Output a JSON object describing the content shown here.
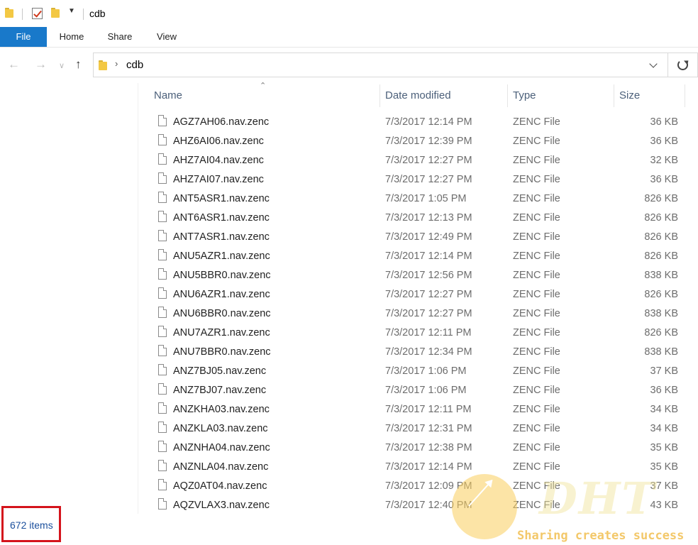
{
  "window": {
    "title": "cdb"
  },
  "ribbon": {
    "tabs": [
      "File",
      "Home",
      "Share",
      "View"
    ]
  },
  "address": {
    "path": "cdb"
  },
  "columns": {
    "name": "Name",
    "date": "Date modified",
    "type": "Type",
    "size": "Size"
  },
  "files": [
    {
      "name": "AGZ7AH06.nav.zenc",
      "date": "7/3/2017 12:14 PM",
      "type": "ZENC File",
      "size": "36 KB"
    },
    {
      "name": "AHZ6AI06.nav.zenc",
      "date": "7/3/2017 12:39 PM",
      "type": "ZENC File",
      "size": "36 KB"
    },
    {
      "name": "AHZ7AI04.nav.zenc",
      "date": "7/3/2017 12:27 PM",
      "type": "ZENC File",
      "size": "32 KB"
    },
    {
      "name": "AHZ7AI07.nav.zenc",
      "date": "7/3/2017 12:27 PM",
      "type": "ZENC File",
      "size": "36 KB"
    },
    {
      "name": "ANT5ASR1.nav.zenc",
      "date": "7/3/2017 1:05 PM",
      "type": "ZENC File",
      "size": "826 KB"
    },
    {
      "name": "ANT6ASR1.nav.zenc",
      "date": "7/3/2017 12:13 PM",
      "type": "ZENC File",
      "size": "826 KB"
    },
    {
      "name": "ANT7ASR1.nav.zenc",
      "date": "7/3/2017 12:49 PM",
      "type": "ZENC File",
      "size": "826 KB"
    },
    {
      "name": "ANU5AZR1.nav.zenc",
      "date": "7/3/2017 12:14 PM",
      "type": "ZENC File",
      "size": "826 KB"
    },
    {
      "name": "ANU5BBR0.nav.zenc",
      "date": "7/3/2017 12:56 PM",
      "type": "ZENC File",
      "size": "838 KB"
    },
    {
      "name": "ANU6AZR1.nav.zenc",
      "date": "7/3/2017 12:27 PM",
      "type": "ZENC File",
      "size": "826 KB"
    },
    {
      "name": "ANU6BBR0.nav.zenc",
      "date": "7/3/2017 12:27 PM",
      "type": "ZENC File",
      "size": "838 KB"
    },
    {
      "name": "ANU7AZR1.nav.zenc",
      "date": "7/3/2017 12:11 PM",
      "type": "ZENC File",
      "size": "826 KB"
    },
    {
      "name": "ANU7BBR0.nav.zenc",
      "date": "7/3/2017 12:34 PM",
      "type": "ZENC File",
      "size": "838 KB"
    },
    {
      "name": "ANZ7BJ05.nav.zenc",
      "date": "7/3/2017 1:06 PM",
      "type": "ZENC File",
      "size": "37 KB"
    },
    {
      "name": "ANZ7BJ07.nav.zenc",
      "date": "7/3/2017 1:06 PM",
      "type": "ZENC File",
      "size": "36 KB"
    },
    {
      "name": "ANZKHA03.nav.zenc",
      "date": "7/3/2017 12:11 PM",
      "type": "ZENC File",
      "size": "34 KB"
    },
    {
      "name": "ANZKLA03.nav.zenc",
      "date": "7/3/2017 12:31 PM",
      "type": "ZENC File",
      "size": "34 KB"
    },
    {
      "name": "ANZNHA04.nav.zenc",
      "date": "7/3/2017 12:38 PM",
      "type": "ZENC File",
      "size": "35 KB"
    },
    {
      "name": "ANZNLA04.nav.zenc",
      "date": "7/3/2017 12:14 PM",
      "type": "ZENC File",
      "size": "35 KB"
    },
    {
      "name": "AQZ0AT04.nav.zenc",
      "date": "7/3/2017 12:09 PM",
      "type": "ZENC File",
      "size": "37 KB"
    },
    {
      "name": "AQZVLAX3.nav.zenc",
      "date": "7/3/2017 12:40 PM",
      "type": "ZENC File",
      "size": "43 KB"
    }
  ],
  "status": {
    "item_count": "672 items"
  },
  "watermark": {
    "logo": "DHT",
    "tagline": "Sharing creates success"
  },
  "colors": {
    "file_tab": "#1979ca",
    "highlight_border": "#d4141c",
    "folder": "#f3c844",
    "watermark": "#f3c86a"
  }
}
